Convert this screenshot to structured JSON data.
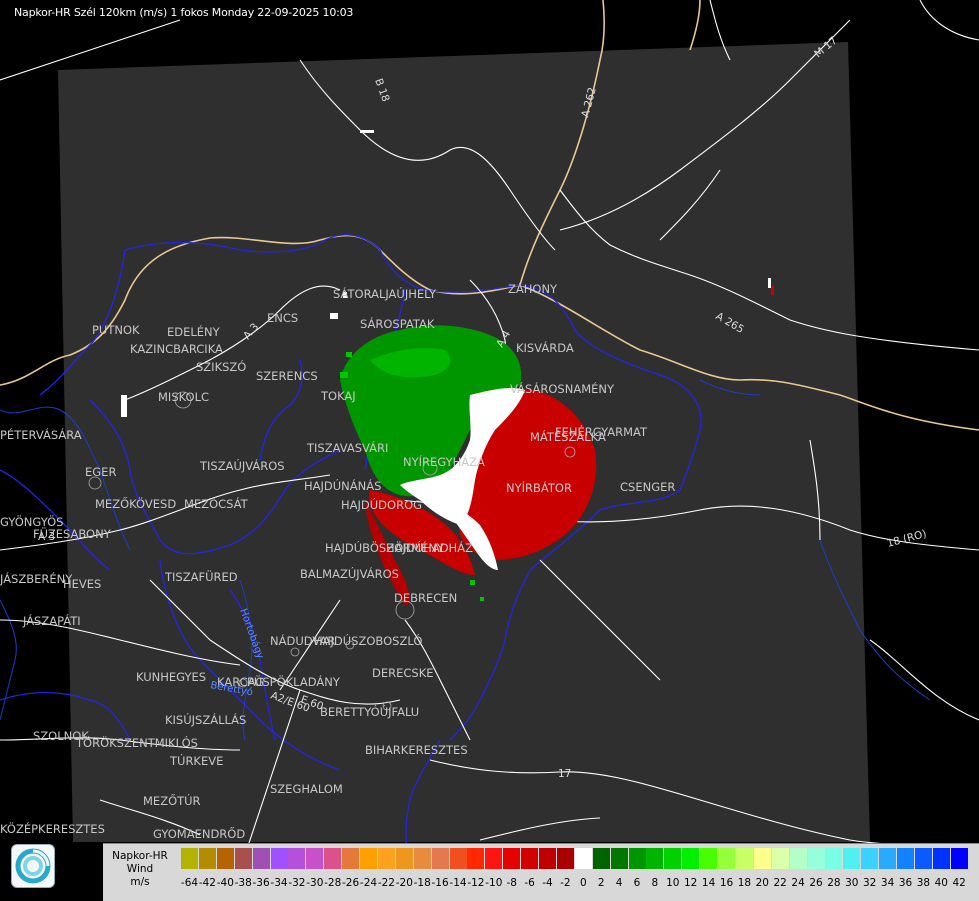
{
  "header": "Napkor-HR Szél 120km (m/s) 1 fokos Monday 22-09-2025 10:03",
  "towns": [
    {
      "name": "SÁTORALJAÚJHELY",
      "short": "satoraljaujhely"
    },
    {
      "name": "SÁROSPATAK",
      "short": "sarospatak"
    },
    {
      "name": "ZÁHONY",
      "short": "zahony"
    },
    {
      "name": "KISVÁRDA",
      "short": "kisvarda"
    },
    {
      "name": "ENCS",
      "short": "encs"
    },
    {
      "name": "PUTNOK",
      "short": "putnok"
    },
    {
      "name": "EDELÉNY",
      "short": "edeleny"
    },
    {
      "name": "KAZINCBARCIKA",
      "short": "kazincbarcika"
    },
    {
      "name": "SZIKSZÓ",
      "short": "szikszo"
    },
    {
      "name": "SZERENCS",
      "short": "szerencs"
    },
    {
      "name": "TOKAJ",
      "short": "tokaj"
    },
    {
      "name": "VÁSÁROSNAMÉNY",
      "short": "vasarosnameny"
    },
    {
      "name": "MISKOLC",
      "short": "miskolc"
    },
    {
      "name": "MÁTÉSZALKA",
      "short": "mateszalka"
    },
    {
      "name": "FEHÉRGYARMAT",
      "short": "fehergyarmat"
    },
    {
      "name": "PÉTERVÁSÁRA",
      "short": "petervasara"
    },
    {
      "name": "TISZAVASVÁRI",
      "short": "tiszavasvari"
    },
    {
      "name": "NYÍREGYHÁZA",
      "short": "nyiregyhaza"
    },
    {
      "name": "EGER",
      "short": "eger"
    },
    {
      "name": "TISZAÚJVÁROS",
      "short": "tiszaujvaros"
    },
    {
      "name": "HAJDÚNÁNÁS",
      "short": "hajdunanas"
    },
    {
      "name": "NYÍRBÁTOR",
      "short": "nyirbator"
    },
    {
      "name": "CSENGER",
      "short": "csenger"
    },
    {
      "name": "MEZŐKÖVESD",
      "short": "mezokovesd"
    },
    {
      "name": "MEZŐCSÁT",
      "short": "mezocsat"
    },
    {
      "name": "HAJDÚDOROG",
      "short": "hajdudorog"
    },
    {
      "name": "GYÖNGYÖS",
      "short": "gyongyos"
    },
    {
      "name": "FÜZESABONY",
      "short": "fuzesabony"
    },
    {
      "name": "HAJDÚBÖSZÖRMÉNY",
      "short": "hajduboszormeny"
    },
    {
      "name": "HAJDÚHADHÁZ",
      "short": "hajduhadhaz"
    },
    {
      "name": "TISZAFÜRED",
      "short": "tiszafured"
    },
    {
      "name": "BALMAZÚJVÁROS",
      "short": "balmazujvaros"
    },
    {
      "name": "HEVES",
      "short": "heves"
    },
    {
      "name": "JÁSZAPÁTI",
      "short": "jaszapati"
    },
    {
      "name": "DEBRECEN",
      "short": "debrecen"
    },
    {
      "name": "NÁDUDVAR",
      "short": "nadudvar"
    },
    {
      "name": "HAJDÚSZOBOSZLÓ",
      "short": "hajduszoboszlo"
    },
    {
      "name": "KUNHEGYES",
      "short": "kunhegyes"
    },
    {
      "name": "KARCAG",
      "short": "karcag"
    },
    {
      "name": "PÜSPÖKLADÁNY",
      "short": "puspokladany"
    },
    {
      "name": "DERECSKE",
      "short": "derecske"
    },
    {
      "name": "KISÚJSZÁLLÁS",
      "short": "kisujszallas"
    },
    {
      "name": "BERETTYÓÚJFALU",
      "short": "berettyoujfalu"
    },
    {
      "name": "SZOLNOK",
      "short": "szolnok"
    },
    {
      "name": "TÖRÖKSZENTMIKLÓS",
      "short": "torokszentmiklos"
    },
    {
      "name": "BIHARKERESZTES",
      "short": "biharkeresztes"
    },
    {
      "name": "TÚRKEVE",
      "short": "turkeve"
    },
    {
      "name": "SZEGHALOM",
      "short": "szeghalom"
    },
    {
      "name": "MEZŐTÚR",
      "short": "mezotur"
    },
    {
      "name": "GYOMAENDRŐD",
      "short": "gyomaendrod"
    },
    {
      "name": "KÖZÉPKERESZTES",
      "short": "kozepkeresztes"
    },
    {
      "name": "JÁSZBERÉNY",
      "short": "jaszbereny"
    }
  ],
  "road_labels": [
    "B 18",
    "A 262",
    "M 17",
    "A 265",
    "18 (RO)",
    "17",
    "A 3",
    "A 3",
    "A 4",
    "A2/E 60",
    "E 60"
  ],
  "river_labels": [
    "Hortobágy",
    "Berettyó"
  ],
  "legend": {
    "title_1": "Napkor-HR",
    "title_2": "Wind",
    "title_3": "m/s",
    "scale": [
      {
        "v": "-64",
        "c": "#b4b400"
      },
      {
        "v": "-42",
        "c": "#b48c00"
      },
      {
        "v": "-40",
        "c": "#b46400"
      },
      {
        "v": "-38",
        "c": "#a85050"
      },
      {
        "v": "-36",
        "c": "#a050b4"
      },
      {
        "v": "-34",
        "c": "#a050ff"
      },
      {
        "v": "-32",
        "c": "#b450dc"
      },
      {
        "v": "-30",
        "c": "#c850c8"
      },
      {
        "v": "-28",
        "c": "#dc508c"
      },
      {
        "v": "-26",
        "c": "#e6783c"
      },
      {
        "v": "-24",
        "c": "#ffa000"
      },
      {
        "v": "-22",
        "c": "#ffa01e"
      },
      {
        "v": "-20",
        "c": "#f0961e"
      },
      {
        "v": "-18",
        "c": "#e68c3c"
      },
      {
        "v": "-16",
        "c": "#e67850"
      },
      {
        "v": "-14",
        "c": "#f0501e"
      },
      {
        "v": "-12",
        "c": "#ff2800"
      },
      {
        "v": "-10",
        "c": "#ff1414"
      },
      {
        "v": "-8",
        "c": "#e60000"
      },
      {
        "v": "-6",
        "c": "#d20000"
      },
      {
        "v": "-4",
        "c": "#be0000"
      },
      {
        "v": "-2",
        "c": "#aa0000"
      },
      {
        "v": "0",
        "c": "#ffffff"
      },
      {
        "v": "2",
        "c": "#006400"
      },
      {
        "v": "4",
        "c": "#007800"
      },
      {
        "v": "6",
        "c": "#009600"
      },
      {
        "v": "8",
        "c": "#00b400"
      },
      {
        "v": "10",
        "c": "#00d200"
      },
      {
        "v": "12",
        "c": "#00f000"
      },
      {
        "v": "14",
        "c": "#46ff00"
      },
      {
        "v": "16",
        "c": "#96ff3c"
      },
      {
        "v": "18",
        "c": "#c8ff64"
      },
      {
        "v": "20",
        "c": "#ffff8c"
      },
      {
        "v": "22",
        "c": "#dcffaa"
      },
      {
        "v": "24",
        "c": "#b4ffc8"
      },
      {
        "v": "26",
        "c": "#96ffdc"
      },
      {
        "v": "28",
        "c": "#78ffe6"
      },
      {
        "v": "30",
        "c": "#50f0f0"
      },
      {
        "v": "32",
        "c": "#3cd2ff"
      },
      {
        "v": "34",
        "c": "#28aaff"
      },
      {
        "v": "36",
        "c": "#1482ff"
      },
      {
        "v": "38",
        "c": "#0a5aff"
      },
      {
        "v": "40",
        "c": "#0032ff"
      },
      {
        "v": "42",
        "c": "#0000ff"
      }
    ]
  },
  "colors": {
    "background": "#000000",
    "radar_area": "#2f2f2f",
    "roads": "#ffffff",
    "border": "#e8c890",
    "admin": "#1e1ee6",
    "inbound": "#00a000",
    "outbound": "#d00000"
  }
}
